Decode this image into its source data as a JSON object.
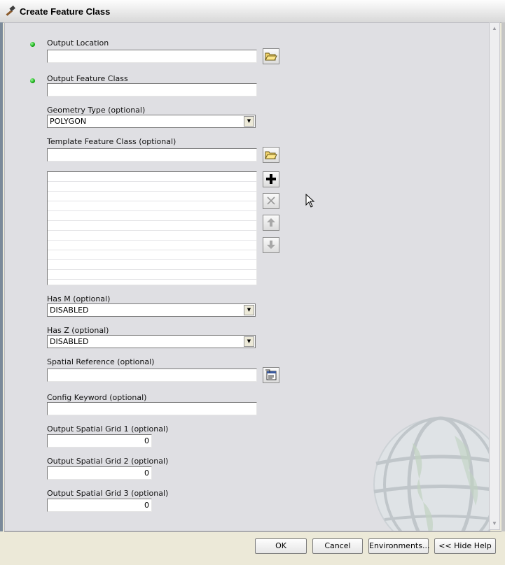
{
  "window": {
    "title": "Create Feature Class"
  },
  "form": {
    "output_location": {
      "label": "Output Location",
      "value": ""
    },
    "output_feature_class": {
      "label": "Output Feature Class",
      "value": ""
    },
    "geometry_type": {
      "label": "Geometry Type (optional)",
      "value": "POLYGON"
    },
    "template_feature_class": {
      "label": "Template Feature Class (optional)",
      "value": ""
    },
    "has_m": {
      "label": "Has M (optional)",
      "value": "DISABLED"
    },
    "has_z": {
      "label": "Has Z (optional)",
      "value": "DISABLED"
    },
    "spatial_reference": {
      "label": "Spatial Reference (optional)",
      "value": ""
    },
    "config_keyword": {
      "label": "Config Keyword (optional)",
      "value": ""
    },
    "grid1": {
      "label": "Output Spatial Grid 1 (optional)",
      "value": "0"
    },
    "grid2": {
      "label": "Output Spatial Grid 2 (optional)",
      "value": "0"
    },
    "grid3": {
      "label": "Output Spatial Grid 3 (optional)",
      "value": "0"
    }
  },
  "buttons": {
    "ok": "OK",
    "cancel": "Cancel",
    "environments": "Environments...",
    "hide_help": "<< Hide Help"
  },
  "icons": {
    "title": "hammer-icon",
    "browse": "folder-open-icon",
    "add": "plus-icon",
    "remove": "x-icon",
    "up": "arrow-up-icon",
    "down": "arrow-down-icon",
    "spatial_ref": "properties-icon"
  },
  "colors": {
    "required_indicator": "#14a814",
    "panel_bg": "#dfdfe3"
  }
}
